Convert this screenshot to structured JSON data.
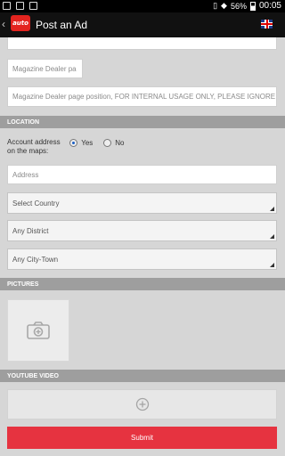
{
  "status_bar": {
    "battery": "56%",
    "time": "00:05"
  },
  "app_bar": {
    "logo_text": "auto",
    "title": "Post an Ad"
  },
  "form": {
    "dealer_name_value": "Magazine Dealer pa",
    "dealer_position_value": "Magazine Dealer page position, FOR INTERNAL USAGE ONLY, PLEASE IGNORE",
    "location_section": "LOCATION",
    "account_address_label": "Account address on the maps:",
    "radio_yes": "Yes",
    "radio_no": "No",
    "radio_selected": "Yes",
    "address_placeholder": "Address",
    "country_select": "Select Country",
    "district_select": "Any District",
    "city_select": "Any City-Town",
    "pictures_section": "PICTURES",
    "youtube_section": "YOUTUBE VIDEO",
    "submit_label": "Submit"
  },
  "colors": {
    "accent": "#e63340",
    "section_bg": "#9e9e9e",
    "app_bar_bg": "#111111"
  }
}
